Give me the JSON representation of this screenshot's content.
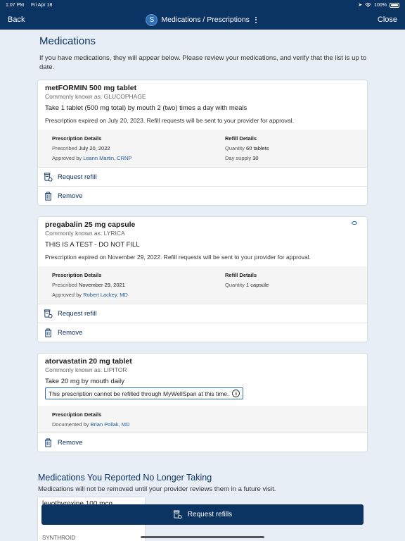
{
  "status_bar": {
    "time": "1:07 PM",
    "date": "Fri Apr 18",
    "battery": "100%"
  },
  "nav": {
    "back_label": "Back",
    "avatar_initial": "S",
    "title": "Medications / Prescriptions",
    "close_label": "Close"
  },
  "page": {
    "title": "Medications",
    "intro": "If you have medications, they will appear below. Please review your medications, and verify that the list is up to date."
  },
  "medications": [
    {
      "name": "metFORMIN 500 mg tablet",
      "aka": "Commonly known as: GLUCOPHAGE",
      "instructions": "Take 1 tablet (500 mg total) by mouth 2 (two) times a day with meals",
      "expired": "Prescription expired on July 20, 2023. Refill requests will be sent to your provider for approval.",
      "details_label": "Prescription Details",
      "prescribed_label": "Prescribed",
      "prescribed_date": "July 20, 2022",
      "approved_label": "Approved by",
      "approved_by": "Leann Martin, CRNP",
      "refill_label": "Refill Details",
      "quantity_label": "Quantity",
      "quantity": "60 tablets",
      "day_supply_label": "Day supply",
      "day_supply": "30",
      "request_refill": "Request refill",
      "remove": "Remove"
    },
    {
      "name": "pregabalin 25 mg capsule",
      "aka": "Commonly known as: LYRICA",
      "instructions": "THIS IS A TEST - DO NOT FILL",
      "expired": "Prescription expired on November 29, 2022. Refill requests will be sent to your provider for approval.",
      "details_label": "Prescription Details",
      "prescribed_label": "Prescribed",
      "prescribed_date": "November 29, 2021",
      "approved_label": "Approved by",
      "approved_by": "Robert Lackey, MD",
      "refill_label": "Refill Details",
      "quantity_label": "Quantity",
      "quantity": "1 capsule",
      "request_refill": "Request refill",
      "remove": "Remove"
    },
    {
      "name": "atorvastatin 20 mg tablet",
      "aka": "Commonly known as: LIPITOR",
      "instructions": "Take 20 mg by mouth daily",
      "notice": "This prescription cannot be refilled through MyWellSpan at this time.",
      "details_label": "Prescription Details",
      "documented_label": "Documented by",
      "documented_by": "Brian Pollak, MD",
      "remove": "Remove"
    }
  ],
  "no_longer_taking": {
    "title": "Medications You Reported No Longer Taking",
    "text": "Medications will not be removed until your provider reviews them in a future visit.",
    "partial_name": "levothyroxine 100 mcg",
    "partial_aka": "SYNTHROID"
  },
  "footer": {
    "request_refills": "Request refills"
  },
  "colors": {
    "nav": "#0b3463",
    "accent": "#1f5a9c",
    "background": "#e8eef6"
  },
  "icons": [
    "wifi-icon",
    "battery-icon",
    "kebab-menu-icon",
    "pill-bottle-refill-icon",
    "trash-icon",
    "watch-icon",
    "info-icon"
  ]
}
